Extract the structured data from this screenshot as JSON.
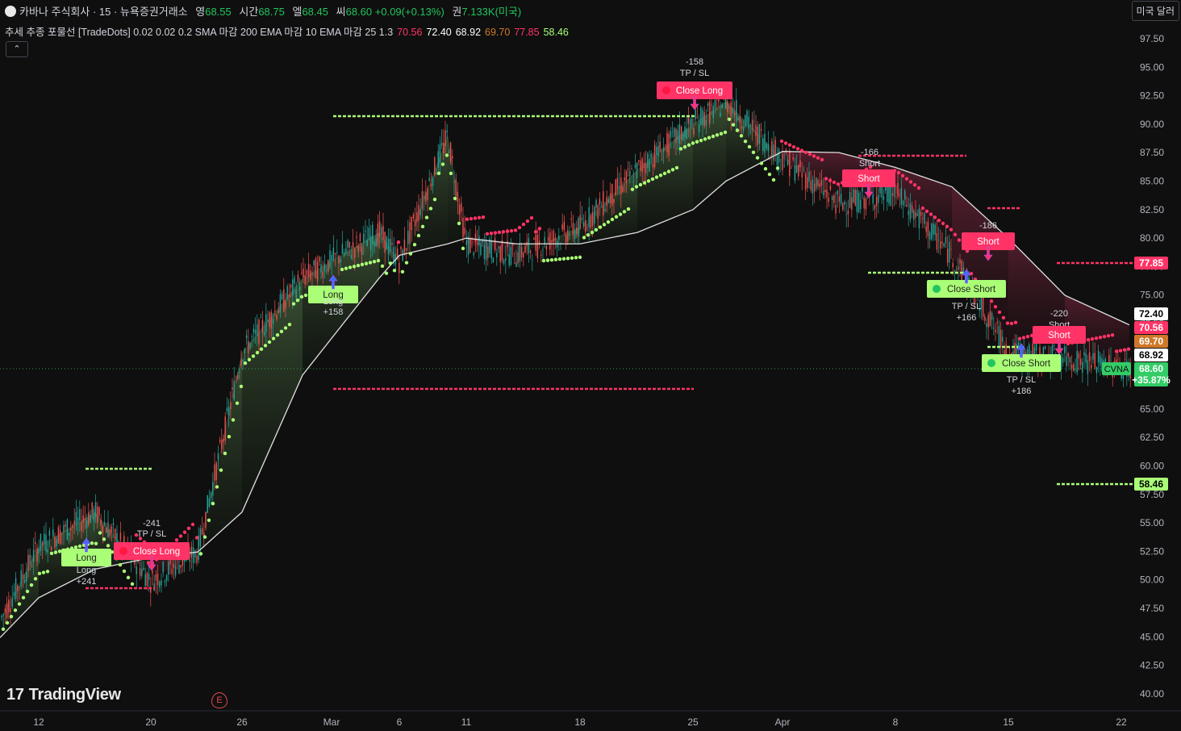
{
  "header": {
    "symbol": "카바나 주식회사 · 15 · 뉴욕증권거래소",
    "open_label": "영",
    "open": "68.55",
    "high_label": "시간",
    "high": "68.75",
    "low_label": "엘",
    "low": "68.45",
    "close_label": "씨",
    "close": "68.60",
    "change": "+0.09(+0.13%)",
    "volume_label": "권",
    "volume": "7.133K(미국)"
  },
  "indicator": {
    "name": "추세 추종 포물선 [TradeDots] 0.02 0.02 0.2 SMA 마감 200 EMA 마감 10 EMA 마감 25 1.3",
    "v1": "70.56",
    "v2": "72.40",
    "v3": "68.92",
    "v4": "69.70",
    "v5": "77.85",
    "v6": "58.46"
  },
  "collapse_glyph": "⌃",
  "currency_button": "미국 달러",
  "logo_text": "TradingView",
  "logo_mark": "17",
  "earnings_icon": "E",
  "colors": {
    "bull": "#aaff77",
    "bear": "#ff3366",
    "sma": "#e0e0e0",
    "background": "#0f0f0f"
  },
  "y_axis": {
    "ticks": [
      "97.50",
      "95.00",
      "92.50",
      "90.00",
      "87.50",
      "85.00",
      "82.50",
      "80.00",
      "77.50",
      "75.00",
      "72.50",
      "70.00",
      "67.50",
      "65.00",
      "62.50",
      "60.00",
      "57.50",
      "55.00",
      "52.50",
      "50.00",
      "47.50",
      "45.00",
      "42.50",
      "40.00"
    ],
    "badges": [
      {
        "text": "77.85",
        "bg": "#ff3366",
        "fg": "#ffffff"
      },
      {
        "text": "72.40",
        "bg": "#ffffff",
        "fg": "#000000"
      },
      {
        "text": "70.56",
        "bg": "#ff3366",
        "fg": "#ffffff"
      },
      {
        "text": "69.70",
        "bg": "#d0782a",
        "fg": "#ffffff"
      },
      {
        "text": "68.92",
        "bg": "#ffffff",
        "fg": "#000000"
      },
      {
        "text": "68.60",
        "bg": "#33cc66",
        "fg": "#ffffff"
      },
      {
        "text": "+35.87%",
        "bg": "#33cc66",
        "fg": "#ffffff"
      },
      {
        "text": "58.46",
        "bg": "#aaff77",
        "fg": "#000000"
      }
    ]
  },
  "x_axis": {
    "ticks": [
      "12",
      "20",
      "26",
      "Mar",
      "6",
      "11",
      "18",
      "25",
      "Apr",
      "8",
      "15",
      "22"
    ]
  },
  "symbol_tag": "CVNA",
  "signals": [
    {
      "text": "Long",
      "type": "long"
    },
    {
      "text": "Long",
      "type": "small"
    },
    {
      "text": "+241",
      "type": "small"
    },
    {
      "text": "-241",
      "type": "small"
    },
    {
      "text": "TP / SL",
      "type": "small"
    },
    {
      "text": "Close Long",
      "type": "close_long"
    },
    {
      "text": "Long",
      "type": "long"
    },
    {
      "text": "Long",
      "type": "small"
    },
    {
      "text": "+158",
      "type": "small"
    },
    {
      "text": "-158",
      "type": "small"
    },
    {
      "text": "TP / SL",
      "type": "small"
    },
    {
      "text": "Close Long",
      "type": "close_long"
    },
    {
      "text": "-166",
      "type": "small"
    },
    {
      "text": "Short",
      "type": "small"
    },
    {
      "text": "Short",
      "type": "short"
    },
    {
      "text": "-186",
      "type": "small"
    },
    {
      "text": "Short",
      "type": "small"
    },
    {
      "text": "Short",
      "type": "short"
    },
    {
      "text": "Close Short",
      "type": "close_short"
    },
    {
      "text": "TP / SL",
      "type": "small"
    },
    {
      "text": "+166",
      "type": "small"
    },
    {
      "text": "-220",
      "type": "small"
    },
    {
      "text": "Short",
      "type": "small"
    },
    {
      "text": "Short",
      "type": "short"
    },
    {
      "text": "Close Short",
      "type": "close_short"
    },
    {
      "text": "TP / SL",
      "type": "small"
    },
    {
      "text": "+186",
      "type": "small"
    }
  ],
  "chart_data": {
    "type": "line",
    "symbol": "CVNA",
    "interval": "15",
    "price_scale": "USD",
    "x": [
      "Feb 9",
      "Feb 12",
      "Feb 16",
      "Feb 20",
      "Feb 23",
      "Feb 26",
      "Mar 1",
      "Mar 4",
      "Mar 6",
      "Mar 8",
      "Mar 11",
      "Mar 14",
      "Mar 18",
      "Mar 21",
      "Mar 25",
      "Mar 27",
      "Apr 1",
      "Apr 4",
      "Apr 8",
      "Apr 11",
      "Apr 15",
      "Apr 18",
      "Apr 22"
    ],
    "series": [
      {
        "name": "close",
        "values": [
          46.5,
          53.0,
          56.0,
          50.0,
          52.5,
          70.0,
          76.5,
          80.5,
          78.0,
          89.0,
          79.5,
          78.5,
          81.0,
          86.0,
          90.0,
          92.0,
          87.0,
          83.0,
          84.0,
          78.5,
          70.0,
          69.5,
          68.6
        ]
      },
      {
        "name": "SMA 200",
        "values": [
          45.0,
          48.5,
          51.0,
          52.0,
          52.5,
          56.0,
          68.0,
          76.5,
          78.5,
          79.5,
          80.0,
          79.5,
          79.5,
          80.5,
          82.5,
          85.0,
          87.6,
          87.5,
          86.2,
          84.5,
          80.0,
          75.0,
          72.4
        ]
      }
    ],
    "ylim": [
      40,
      97.5
    ],
    "grid": false
  }
}
